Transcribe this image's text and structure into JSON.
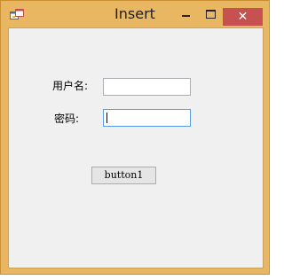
{
  "window": {
    "title": "Insert",
    "icon": "winforms-app-icon",
    "caption_buttons": {
      "minimize_icon": "minimize-icon",
      "maximize_icon": "maximize-icon",
      "close_glyph": "✕"
    },
    "colors": {
      "frame": "#e9b662",
      "close_button": "#c75050",
      "client_background": "#f0f0f0",
      "focused_border": "#569de5"
    }
  },
  "form": {
    "username_label": "用户名:",
    "username_value": "",
    "password_label": "密码:",
    "password_value": "",
    "submit_label": "button1"
  }
}
